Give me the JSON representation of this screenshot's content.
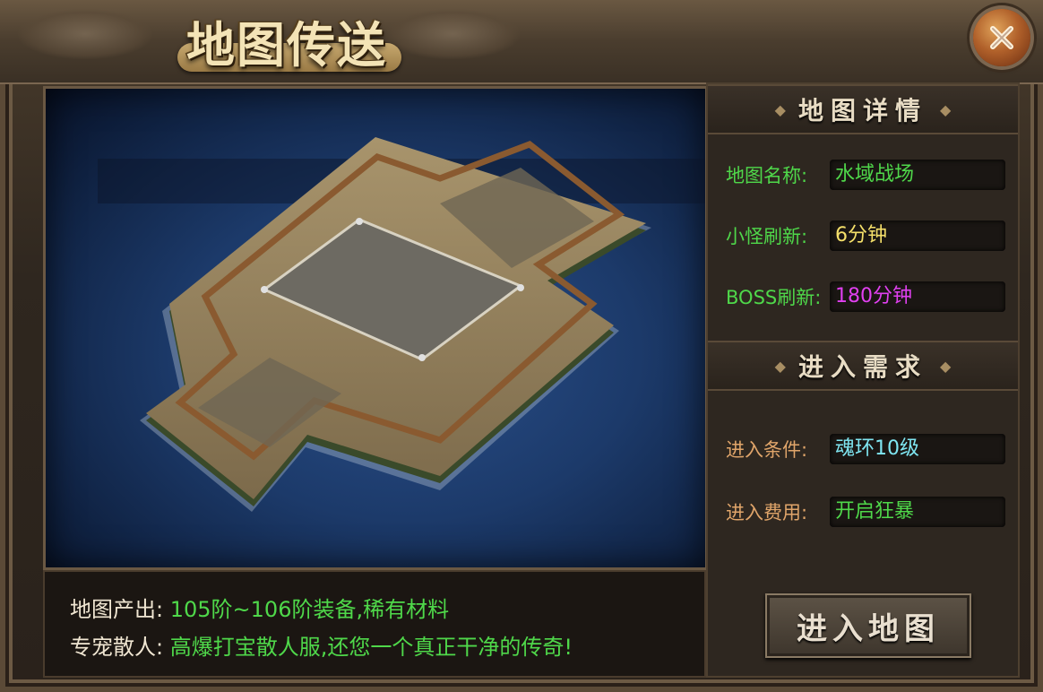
{
  "window": {
    "title": "地图传送"
  },
  "map_details": {
    "header": "地图详情",
    "name_label": "地图名称:",
    "name_value": "水域战场",
    "minion_refresh_label": "小怪刷新:",
    "minion_refresh_value": "6分钟",
    "boss_refresh_label": "BOSS刷新:",
    "boss_refresh_value": "180分钟"
  },
  "requirements": {
    "header": "进入需求",
    "condition_label": "进入条件:",
    "condition_value": "魂环10级",
    "cost_label": "进入费用:",
    "cost_value": "开启狂暴"
  },
  "info": {
    "output_label": "地图产出:",
    "output_value": "105阶~106阶装备,稀有材料",
    "pet_label": "专宠散人:",
    "pet_value": "高爆打宝散人服,还您一个真正干净的传奇!"
  },
  "buttons": {
    "enter": "进入地图"
  },
  "colors": {
    "green_text": "#4fd84a",
    "yellow_text": "#f5e06a",
    "magenta_text": "#e040f0",
    "cyan_text": "#7fe6f2",
    "gold_label": "#e0a56a"
  },
  "icons": {
    "close": "close-x-icon"
  }
}
